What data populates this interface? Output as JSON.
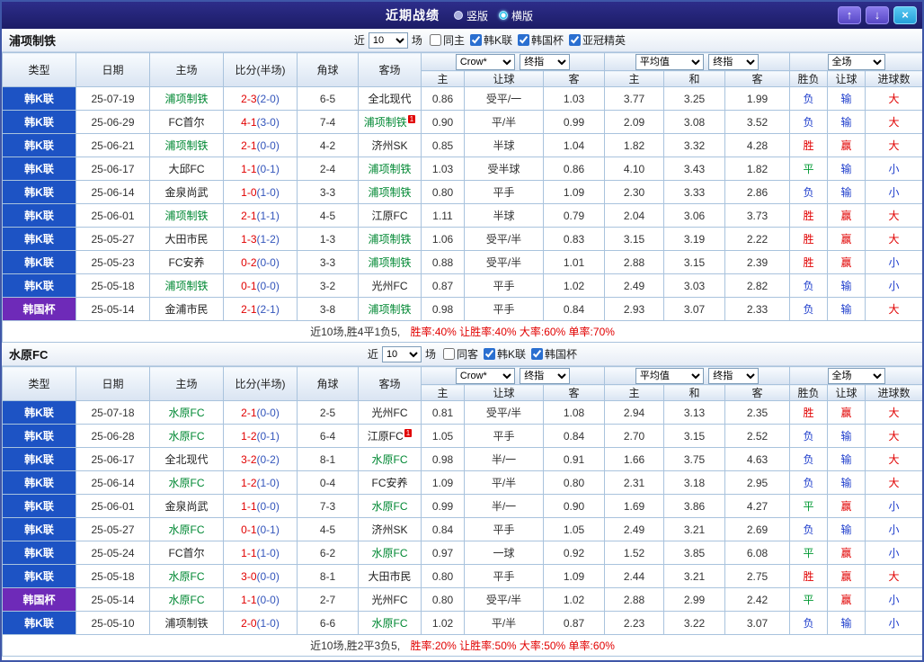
{
  "titlebar": {
    "title": "近期战绩",
    "layout_options": [
      {
        "label": "竖版",
        "selected": false
      },
      {
        "label": "横版",
        "selected": true
      }
    ],
    "icons": {
      "up": "↑",
      "down": "↓",
      "close": "×"
    }
  },
  "filter_labels": {
    "recent": "近",
    "games": "场"
  },
  "columns": {
    "type": "类型",
    "date": "日期",
    "home": "主场",
    "score": "比分(半场)",
    "corner": "角球",
    "away": "客场",
    "handicap": [
      "主",
      "让球",
      "客"
    ],
    "euro": [
      "主",
      "和",
      "客"
    ],
    "result": [
      "胜负",
      "让球",
      "进球数"
    ]
  },
  "sections": [
    {
      "team": "浦项制铁",
      "filter": {
        "recent_value": "10",
        "checkboxes": [
          {
            "label": "同主",
            "checked": false
          },
          {
            "label": "韩K联",
            "checked": true
          },
          {
            "label": "韩国杯",
            "checked": true
          },
          {
            "label": "亚冠精英",
            "checked": true
          }
        ]
      },
      "selects": {
        "handicap_source": "Crow*",
        "handicap_time": "终指",
        "euro_source": "平均值",
        "euro_time": "终指",
        "scope": "全场"
      },
      "rows": [
        {
          "league": "韩K联",
          "date": "25-07-19",
          "home": "浦项制铁",
          "score": "2-3",
          "half": "(2-0)",
          "corner": "6-5",
          "away": "全北现代",
          "h": [
            "0.86",
            "受平/一",
            "1.03"
          ],
          "e": [
            "3.77",
            "3.25",
            "1.99"
          ],
          "r": [
            "负",
            "输",
            "大"
          ]
        },
        {
          "league": "韩K联",
          "date": "25-06-29",
          "home": "FC首尔",
          "score": "4-1",
          "half": "(3-0)",
          "corner": "7-4",
          "away": "浦项制铁",
          "away_card": "1",
          "h": [
            "0.90",
            "平/半",
            "0.99"
          ],
          "e": [
            "2.09",
            "3.08",
            "3.52"
          ],
          "r": [
            "负",
            "输",
            "大"
          ]
        },
        {
          "league": "韩K联",
          "date": "25-06-21",
          "home": "浦项制铁",
          "score": "2-1",
          "half": "(0-0)",
          "corner": "4-2",
          "away": "济州SK",
          "h": [
            "0.85",
            "半球",
            "1.04"
          ],
          "e": [
            "1.82",
            "3.32",
            "4.28"
          ],
          "r": [
            "胜",
            "赢",
            "大"
          ]
        },
        {
          "league": "韩K联",
          "date": "25-06-17",
          "home": "大邱FC",
          "score": "1-1",
          "half": "(0-1)",
          "corner": "2-4",
          "away": "浦项制铁",
          "h": [
            "1.03",
            "受半球",
            "0.86"
          ],
          "e": [
            "4.10",
            "3.43",
            "1.82"
          ],
          "r": [
            "平",
            "输",
            "小"
          ]
        },
        {
          "league": "韩K联",
          "date": "25-06-14",
          "home": "金泉尚武",
          "score": "1-0",
          "half": "(1-0)",
          "corner": "3-3",
          "away": "浦项制铁",
          "h": [
            "0.80",
            "平手",
            "1.09"
          ],
          "e": [
            "2.30",
            "3.33",
            "2.86"
          ],
          "r": [
            "负",
            "输",
            "小"
          ]
        },
        {
          "league": "韩K联",
          "date": "25-06-01",
          "home": "浦项制铁",
          "score": "2-1",
          "half": "(1-1)",
          "corner": "4-5",
          "away": "江原FC",
          "h": [
            "1.11",
            "半球",
            "0.79"
          ],
          "e": [
            "2.04",
            "3.06",
            "3.73"
          ],
          "r": [
            "胜",
            "赢",
            "大"
          ]
        },
        {
          "league": "韩K联",
          "date": "25-05-27",
          "home": "大田市民",
          "score": "1-3",
          "half": "(1-2)",
          "corner": "1-3",
          "away": "浦项制铁",
          "h": [
            "1.06",
            "受平/半",
            "0.83"
          ],
          "e": [
            "3.15",
            "3.19",
            "2.22"
          ],
          "r": [
            "胜",
            "赢",
            "大"
          ]
        },
        {
          "league": "韩K联",
          "date": "25-05-23",
          "home": "FC安养",
          "score": "0-2",
          "half": "(0-0)",
          "corner": "3-3",
          "away": "浦项制铁",
          "h": [
            "0.88",
            "受平/半",
            "1.01"
          ],
          "e": [
            "2.88",
            "3.15",
            "2.39"
          ],
          "r": [
            "胜",
            "赢",
            "小"
          ]
        },
        {
          "league": "韩K联",
          "date": "25-05-18",
          "home": "浦项制铁",
          "score": "0-1",
          "half": "(0-0)",
          "corner": "3-2",
          "away": "光州FC",
          "h": [
            "0.87",
            "平手",
            "1.02"
          ],
          "e": [
            "2.49",
            "3.03",
            "2.82"
          ],
          "r": [
            "负",
            "输",
            "小"
          ]
        },
        {
          "league": "韩国杯",
          "date": "25-05-14",
          "home": "金浦市民",
          "score": "2-1",
          "half": "(2-1)",
          "corner": "3-8",
          "away": "浦项制铁",
          "h": [
            "0.98",
            "平手",
            "0.84"
          ],
          "e": [
            "2.93",
            "3.07",
            "2.33"
          ],
          "r": [
            "负",
            "输",
            "大"
          ]
        }
      ],
      "summary": {
        "record": "近10场,胜4平1负5,",
        "stats": "胜率:40% 让胜率:40% 大率:60% 单率:70%"
      }
    },
    {
      "team": "水原FC",
      "filter": {
        "recent_value": "10",
        "checkboxes": [
          {
            "label": "同客",
            "checked": false
          },
          {
            "label": "韩K联",
            "checked": true
          },
          {
            "label": "韩国杯",
            "checked": true
          }
        ]
      },
      "selects": {
        "handicap_source": "Crow*",
        "handicap_time": "终指",
        "euro_source": "平均值",
        "euro_time": "终指",
        "scope": "全场"
      },
      "rows": [
        {
          "league": "韩K联",
          "date": "25-07-18",
          "home": "水原FC",
          "score": "2-1",
          "half": "(0-0)",
          "corner": "2-5",
          "away": "光州FC",
          "h": [
            "0.81",
            "受平/半",
            "1.08"
          ],
          "e": [
            "2.94",
            "3.13",
            "2.35"
          ],
          "r": [
            "胜",
            "赢",
            "大"
          ]
        },
        {
          "league": "韩K联",
          "date": "25-06-28",
          "home": "水原FC",
          "score": "1-2",
          "half": "(0-1)",
          "corner": "6-4",
          "away": "江原FC",
          "away_card": "1",
          "h": [
            "1.05",
            "平手",
            "0.84"
          ],
          "e": [
            "2.70",
            "3.15",
            "2.52"
          ],
          "r": [
            "负",
            "输",
            "大"
          ]
        },
        {
          "league": "韩K联",
          "date": "25-06-17",
          "home": "全北现代",
          "score": "3-2",
          "half": "(0-2)",
          "corner": "8-1",
          "away": "水原FC",
          "h": [
            "0.98",
            "半/一",
            "0.91"
          ],
          "e": [
            "1.66",
            "3.75",
            "4.63"
          ],
          "r": [
            "负",
            "输",
            "大"
          ]
        },
        {
          "league": "韩K联",
          "date": "25-06-14",
          "home": "水原FC",
          "score": "1-2",
          "half": "(1-0)",
          "corner": "0-4",
          "away": "FC安养",
          "h": [
            "1.09",
            "平/半",
            "0.80"
          ],
          "e": [
            "2.31",
            "3.18",
            "2.95"
          ],
          "r": [
            "负",
            "输",
            "大"
          ]
        },
        {
          "league": "韩K联",
          "date": "25-06-01",
          "home": "金泉尚武",
          "score": "1-1",
          "half": "(0-0)",
          "corner": "7-3",
          "away": "水原FC",
          "h": [
            "0.99",
            "半/一",
            "0.90"
          ],
          "e": [
            "1.69",
            "3.86",
            "4.27"
          ],
          "r": [
            "平",
            "赢",
            "小"
          ]
        },
        {
          "league": "韩K联",
          "date": "25-05-27",
          "home": "水原FC",
          "score": "0-1",
          "half": "(0-1)",
          "corner": "4-5",
          "away": "济州SK",
          "h": [
            "0.84",
            "平手",
            "1.05"
          ],
          "e": [
            "2.49",
            "3.21",
            "2.69"
          ],
          "r": [
            "负",
            "输",
            "小"
          ]
        },
        {
          "league": "韩K联",
          "date": "25-05-24",
          "home": "FC首尔",
          "score": "1-1",
          "half": "(1-0)",
          "corner": "6-2",
          "away": "水原FC",
          "h": [
            "0.97",
            "一球",
            "0.92"
          ],
          "e": [
            "1.52",
            "3.85",
            "6.08"
          ],
          "r": [
            "平",
            "赢",
            "小"
          ]
        },
        {
          "league": "韩K联",
          "date": "25-05-18",
          "home": "水原FC",
          "score": "3-0",
          "half": "(0-0)",
          "corner": "8-1",
          "away": "大田市民",
          "h": [
            "0.80",
            "平手",
            "1.09"
          ],
          "e": [
            "2.44",
            "3.21",
            "2.75"
          ],
          "r": [
            "胜",
            "赢",
            "大"
          ]
        },
        {
          "league": "韩国杯",
          "date": "25-05-14",
          "home": "水原FC",
          "score": "1-1",
          "half": "(0-0)",
          "corner": "2-7",
          "away": "光州FC",
          "h": [
            "0.80",
            "受平/半",
            "1.02"
          ],
          "e": [
            "2.88",
            "2.99",
            "2.42"
          ],
          "r": [
            "平",
            "赢",
            "小"
          ]
        },
        {
          "league": "韩K联",
          "date": "25-05-10",
          "home": "浦项制铁",
          "score": "2-0",
          "half": "(1-0)",
          "corner": "6-6",
          "away": "水原FC",
          "h": [
            "1.02",
            "平/半",
            "0.87"
          ],
          "e": [
            "2.23",
            "3.22",
            "3.07"
          ],
          "r": [
            "负",
            "输",
            "小"
          ]
        }
      ],
      "summary": {
        "record": "近10场,胜2平3负5,",
        "stats": "胜率:20% 让胜率:50% 大率:50% 单率:60%"
      }
    }
  ]
}
